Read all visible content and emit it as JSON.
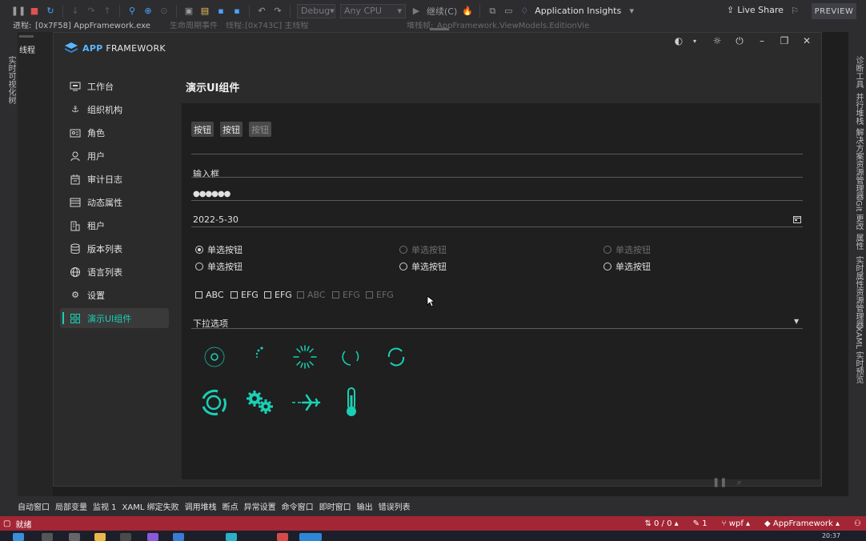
{
  "toolbar": {
    "config": "Debug",
    "platform": "Any CPU",
    "continue": "继续(C)",
    "insights": "Application Insights",
    "live_share": "Live Share",
    "preview": "PREVIEW"
  },
  "row2": {
    "process_label": "进程:",
    "process_value": "[0x7F58] AppFramework.exe",
    "lifecycle": "生命周期事件",
    "thread_label": "线程:",
    "thread_value": "[0x743C] 主线程",
    "stack_label": "堆栈帧:",
    "stack_value": "AppFramework.ViewModels.EditionVie"
  },
  "left_panel": {
    "threads": "线程",
    "vertical": "实时可视化树"
  },
  "right_panel": [
    "诊断工具",
    "并行堆栈",
    "解决方案资源管理器",
    "Git 更改",
    "属性",
    "实时属性资源管理器",
    "XAML 实时预览"
  ],
  "app": {
    "logo_accent": "APP",
    "logo_rest": " FRAMEWORK",
    "page_title": "演示UI组件",
    "nav": [
      {
        "label": "工作台",
        "icon": "monitor-icon"
      },
      {
        "label": "组织机构",
        "icon": "anchor-icon"
      },
      {
        "label": "角色",
        "icon": "id-card-icon"
      },
      {
        "label": "用户",
        "icon": "user-icon"
      },
      {
        "label": "审计日志",
        "icon": "calendar-icon"
      },
      {
        "label": "动态属性",
        "icon": "list-icon"
      },
      {
        "label": "租户",
        "icon": "building-icon"
      },
      {
        "label": "版本列表",
        "icon": "database-icon"
      },
      {
        "label": "语言列表",
        "icon": "globe-icon"
      },
      {
        "label": "设置",
        "icon": "gear-icon"
      },
      {
        "label": "演示UI组件",
        "icon": "grid-icon"
      }
    ],
    "buttons": [
      "按钮",
      "按钮",
      "按钮"
    ],
    "input_value": "输入框",
    "password_value": "●●●●●●",
    "date_value": "2022-5-30",
    "radios": [
      "单选按钮",
      "单选按钮",
      "单选按钮",
      "单选按钮",
      "单选按钮",
      "单选按钮"
    ],
    "checks": [
      "ABC",
      "EFG",
      "EFG",
      "ABC",
      "EFG",
      "EFG"
    ],
    "dropdown": "下拉选项"
  },
  "bottom_tabs": [
    "自动窗口",
    "局部变量",
    "监视 1",
    "XAML 绑定失败",
    "调用堆栈",
    "断点",
    "异常设置",
    "命令窗口",
    "即时窗口",
    "输出",
    "错误列表"
  ],
  "status": {
    "ready": "就绪",
    "errors": "0 / 0",
    "pencil": "1",
    "branch": "wpf",
    "repo": "AppFramework"
  },
  "taskbar": {
    "time": "20:37"
  },
  "colors": {
    "accent": "#19d0b4",
    "status_bar": "#a32635"
  }
}
